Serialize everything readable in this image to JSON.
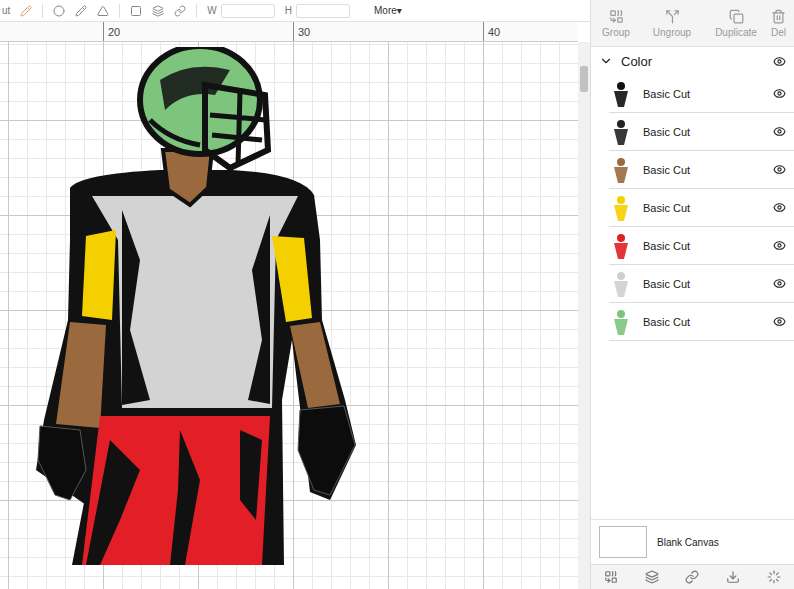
{
  "toolbar": {
    "operation": "ut",
    "width_label": "W",
    "height_label": "H",
    "more": "More▾"
  },
  "ruler": {
    "ticks": [
      "20",
      "30",
      "40"
    ]
  },
  "panel_actions": [
    {
      "label": "Group",
      "disabled": true
    },
    {
      "label": "Ungroup",
      "disabled": true
    },
    {
      "label": "Duplicate",
      "disabled": true
    },
    {
      "label": "Del",
      "disabled": true
    }
  ],
  "layer_group": {
    "label": "Color",
    "expanded": true,
    "visible": true
  },
  "layers": [
    {
      "label": "Basic Cut",
      "visible": true,
      "color": "#111111"
    },
    {
      "label": "Basic Cut",
      "visible": true,
      "color": "#222222"
    },
    {
      "label": "Basic Cut",
      "visible": true,
      "color": "#9a6a3e"
    },
    {
      "label": "Basic Cut",
      "visible": true,
      "color": "#f5d000"
    },
    {
      "label": "Basic Cut",
      "visible": true,
      "color": "#e21f26"
    },
    {
      "label": "Basic Cut",
      "visible": true,
      "color": "#cfcfcf"
    },
    {
      "label": "Basic Cut",
      "visible": true,
      "color": "#7dc47d"
    }
  ],
  "canvas": {
    "label": "Blank Canvas"
  }
}
